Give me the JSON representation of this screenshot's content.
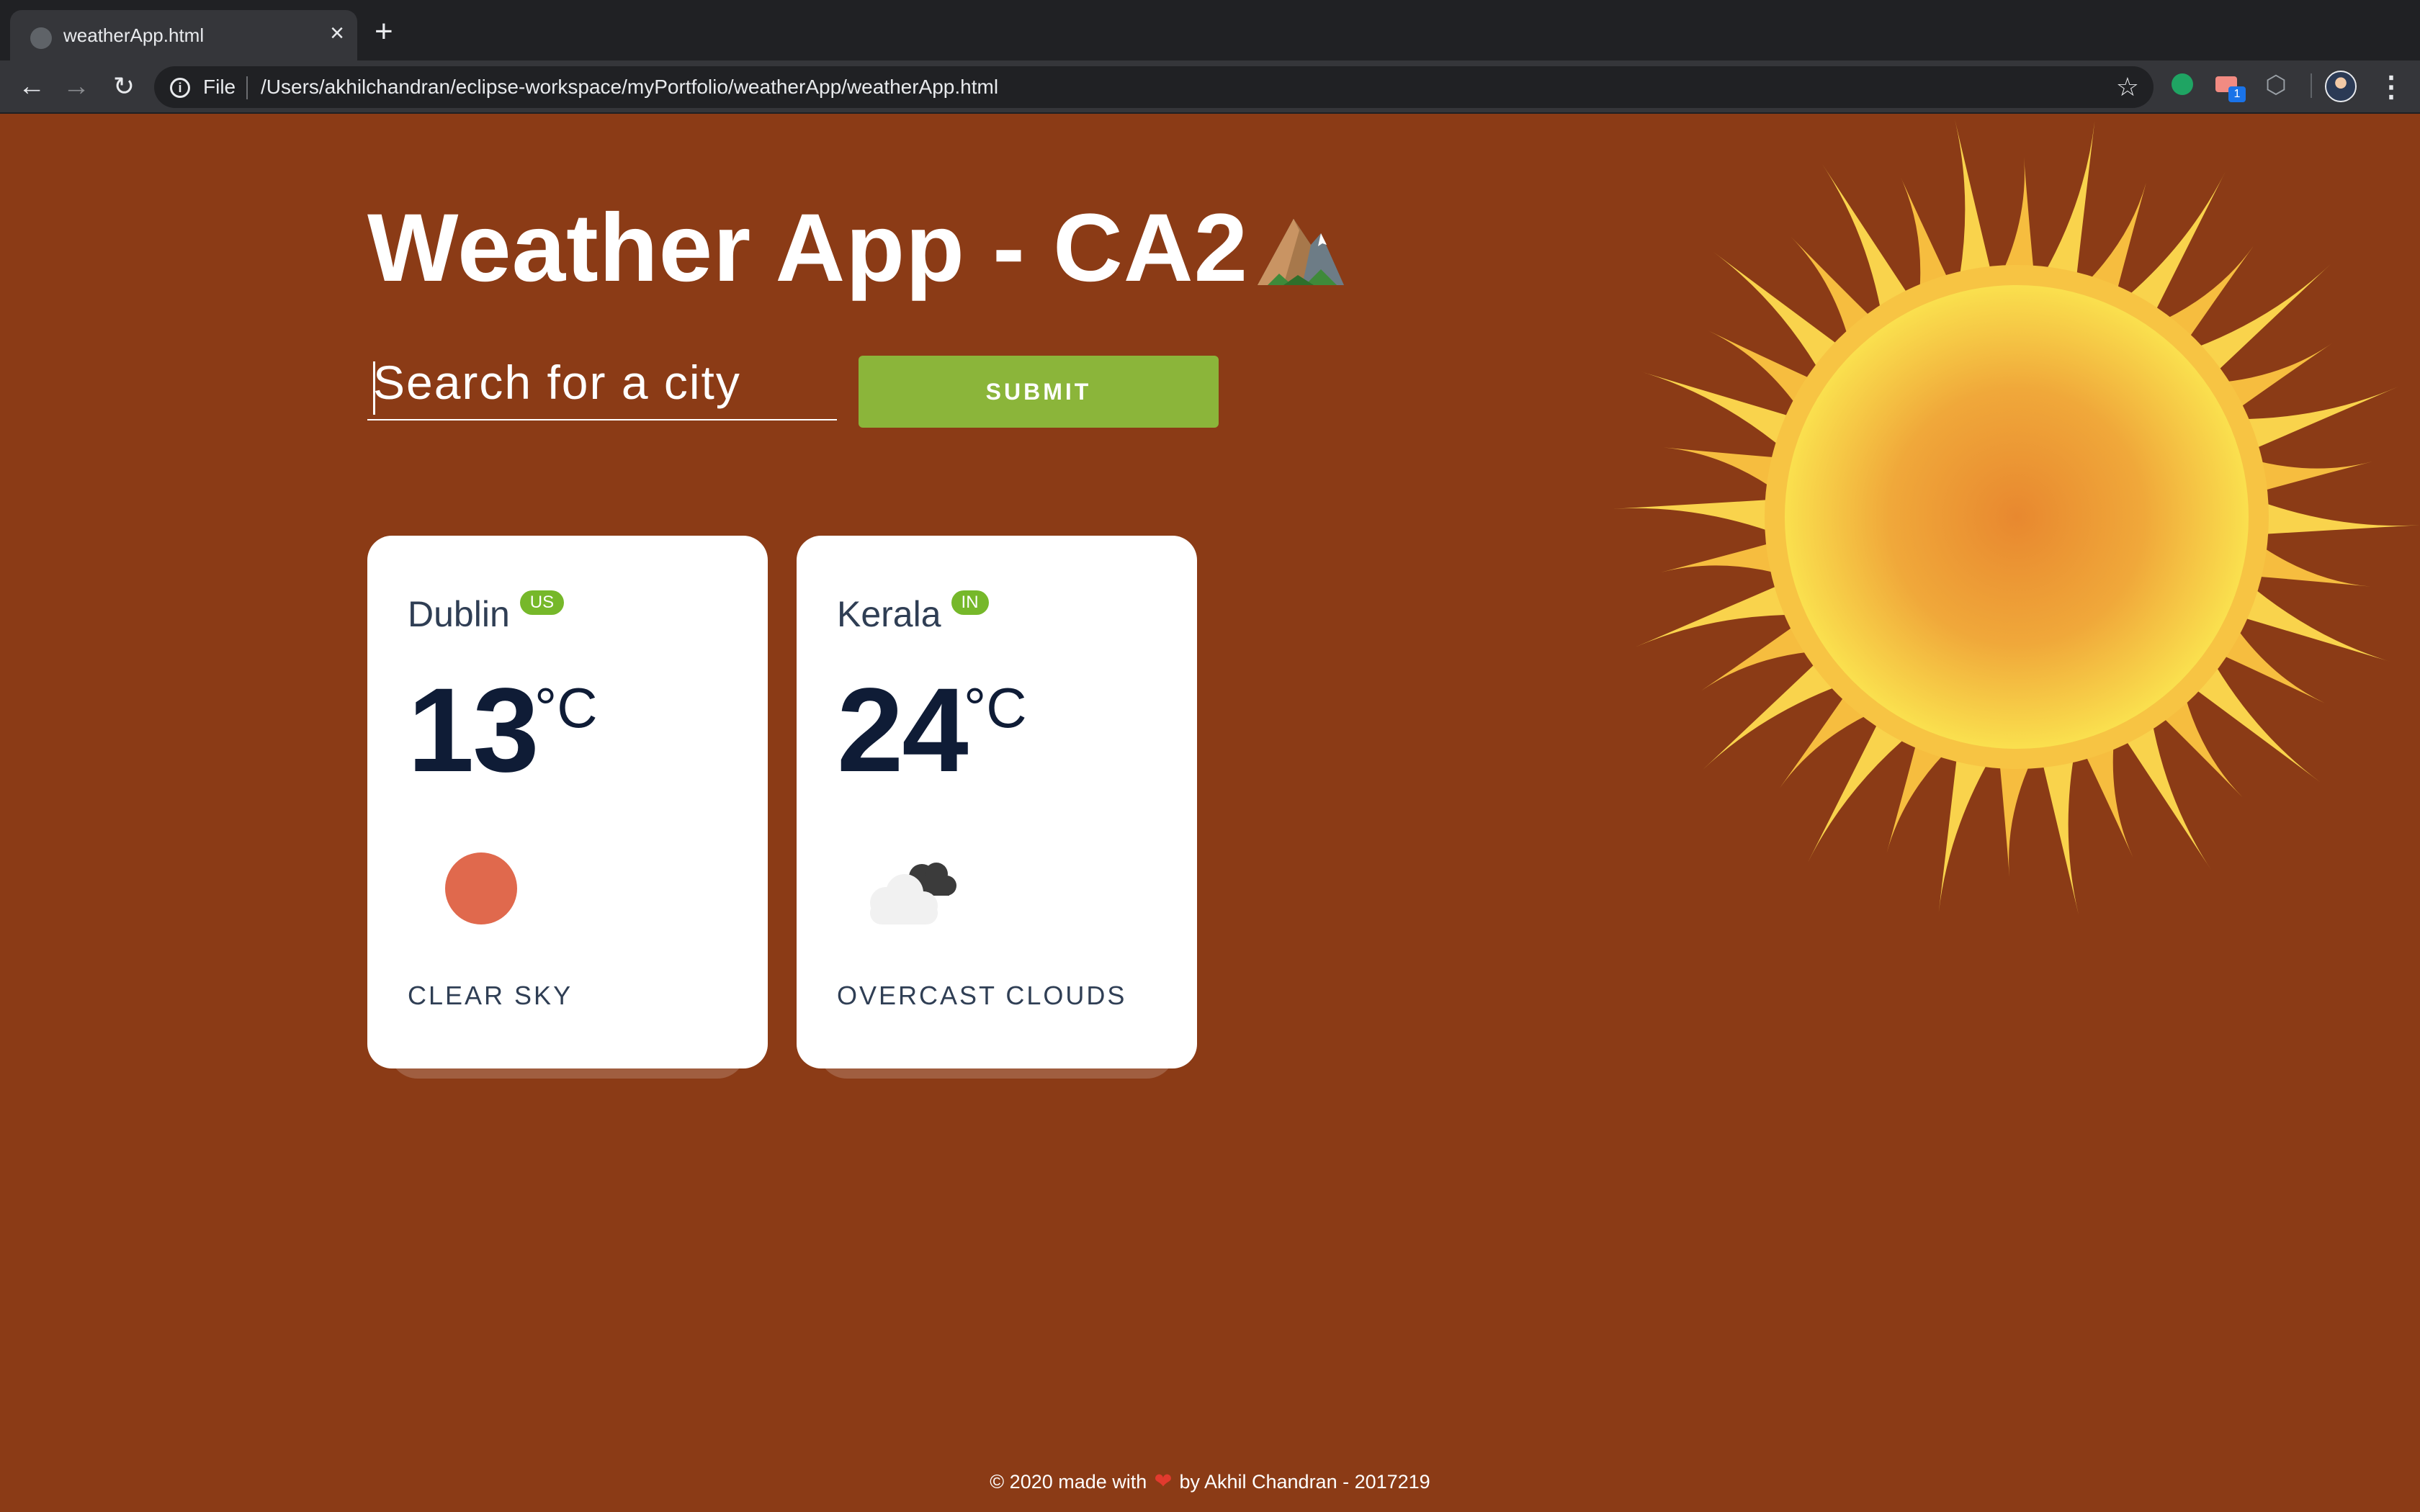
{
  "browser": {
    "tab_title": "weatherApp.html",
    "close_glyph": "×",
    "new_tab_glyph": "+",
    "scheme_label": "File",
    "url": "/Users/akhilchandran/eclipse-workspace/myPortfolio/weatherApp/weatherApp.html",
    "extension_badge": "1"
  },
  "app": {
    "title": "Weather App - CA2",
    "search_placeholder": "Search for a city",
    "submit_label": "SUBMIT"
  },
  "cards": [
    {
      "city": "Dublin",
      "country": "US",
      "temp": "13",
      "unit": "°C",
      "description": "CLEAR SKY",
      "icon": "clear-sky-icon",
      "icon_color": "#E0694D"
    },
    {
      "city": "Kerala",
      "country": "IN",
      "temp": "24",
      "unit": "°C",
      "description": "OVERCAST CLOUDS",
      "icon": "overcast-clouds-icon"
    }
  ],
  "footer": {
    "prefix": "© 2020 made with",
    "suffix": "by Akhil Chandran - 2017219",
    "heart": "❤"
  },
  "colors": {
    "page_background": "#8B3B16",
    "submit_button": "#8BB53A",
    "country_badge": "#76B82A",
    "temperature_text": "#0f1c36"
  }
}
